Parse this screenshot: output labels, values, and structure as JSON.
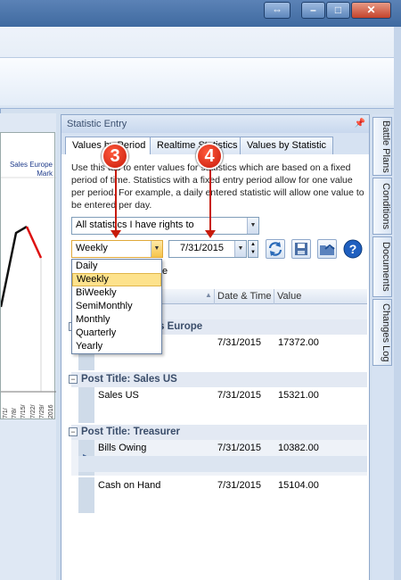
{
  "window": {
    "restore_icon": "⇔",
    "minimize_icon": "–",
    "maximize_icon": "□",
    "close_icon": "✕"
  },
  "chart": {
    "legend_line1": "Sales Europe",
    "legend_line2": "Mark",
    "x_ticks": [
      "7/1/",
      "7/8/",
      "7/15/",
      "7/22/",
      "7/29/",
      "2016"
    ]
  },
  "panel": {
    "title": "Statistic Entry",
    "tabs": [
      "Values by Period",
      "Realtime Statistics",
      "Values by Statistic"
    ],
    "description": "Use this tab to enter values for statistics which are based on a fixed period of time. Statistics with a fixed entry period allow for one value per period. For example, a daily entered statistic will allow one value to be entered per day.",
    "filter_value": "All statistics I have rights to",
    "period_value": "Weekly",
    "date_value": "7/31/2015",
    "period_options": [
      "Daily",
      "Weekly",
      "BiWeekly",
      "SemiMonthly",
      "Monthly",
      "Quarterly",
      "Yearly"
    ],
    "hidden_label_tail": "e"
  },
  "grid": {
    "columns": [
      "Date & Time",
      "Value"
    ],
    "groups": [
      {
        "title": "Post Title:  Sales Europe",
        "title_visible": "s Europe",
        "rows": [
          {
            "name": "",
            "date": "7/31/2015",
            "value": "17372.00"
          }
        ]
      },
      {
        "title": "Post Title:  Sales US",
        "rows": [
          {
            "name": "Sales US",
            "date": "7/31/2015",
            "value": "15321.00"
          }
        ]
      },
      {
        "title": "Post Title:  Treasurer",
        "rows": [
          {
            "name": "Bills Owing",
            "date": "7/31/2015",
            "value": "10382.00"
          },
          {
            "name": "Cash on Hand",
            "date": "7/31/2015",
            "value": "15104.00"
          }
        ]
      }
    ]
  },
  "side_tabs": [
    "Battle Plans",
    "Conditions",
    "Documents",
    "Changes Log"
  ],
  "callouts": [
    "3",
    "4"
  ],
  "colors": {
    "accent": "#c71a0a",
    "highlight": "#fde28c",
    "frame": "#d3e0ef"
  }
}
